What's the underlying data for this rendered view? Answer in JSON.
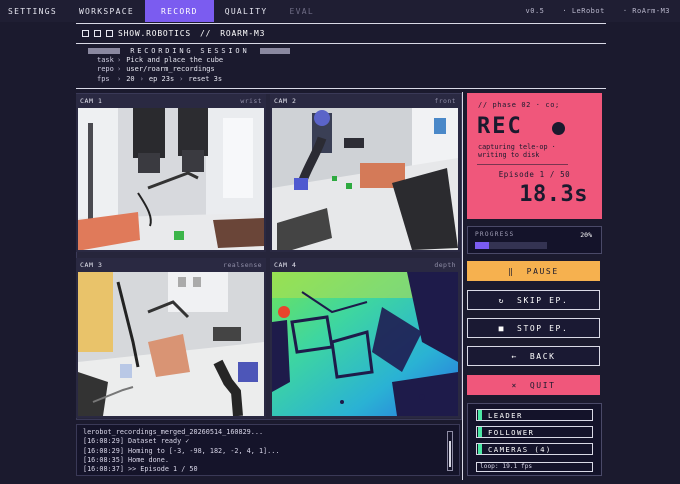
{
  "nav": {
    "tabs": [
      {
        "label": "SETTINGS",
        "state": "normal"
      },
      {
        "label": "WORKSPACE",
        "state": "normal"
      },
      {
        "label": "RECORD",
        "state": "active"
      },
      {
        "label": "QUALITY",
        "state": "normal"
      },
      {
        "label": "EVAL",
        "state": "disabled"
      }
    ],
    "version": "v0.5",
    "app": "LeRobot",
    "robot": "RoArm-M3"
  },
  "header": {
    "brand": "SHOW.ROBOTICS",
    "divider": "//",
    "robot": "ROARM-M3"
  },
  "session": {
    "title": "RECORDING SESSION",
    "task_key": "task",
    "task": "Pick and place the cube",
    "repo_key": "repo",
    "repo": "user/roarm_recordings",
    "fps_key": "fps",
    "fps": "20",
    "episode_time": "ep 23s",
    "reset_time": "reset 3s"
  },
  "cameras": [
    {
      "label": "CAM 1",
      "source": "wrist"
    },
    {
      "label": "CAM 2",
      "source": "front"
    },
    {
      "label": "CAM 3",
      "source": "realsense"
    },
    {
      "label": "CAM 4",
      "source": "depth"
    }
  ],
  "log": {
    "file": "lerobot_recordings_merged_20260514_160829...",
    "lines": [
      "[16:08:29]  Dataset ready ✓",
      "[16:08:29]  Homing to [-3, -98, 182, -2, 4, 1]...",
      "[16:08:35]  Home done.",
      "[16:08:37]  >>  Episode 1 / 50"
    ]
  },
  "recording": {
    "phase": "// phase 02 · co;",
    "state": "REC",
    "caption_1": "capturing tele-op  ·",
    "caption_2": "writing to disk",
    "episode": "Episode  1 / 50",
    "elapsed": "18.3s",
    "color": "#f0577b"
  },
  "progress": {
    "label": "PROGRESS",
    "percent_text": "20%",
    "value": 0.2
  },
  "controls": {
    "pause": {
      "icon": "‖",
      "label": "PAUSE",
      "color": "#f6b14f"
    },
    "skip": {
      "icon": "↻",
      "label": "SKIP EP."
    },
    "stop": {
      "icon": "■",
      "label": "STOP EP."
    },
    "back": {
      "icon": "←",
      "label": "BACK"
    },
    "quit": {
      "icon": "×",
      "label": "QUIT",
      "color": "#f0577b"
    }
  },
  "status": {
    "leader": "LEADER",
    "follower": "FOLLOWER",
    "cameras": "CAMERAS (4)",
    "loop": "loop: 19.1 fps",
    "ok_color": "#4de8a6"
  },
  "accent": "#7b5cf0"
}
